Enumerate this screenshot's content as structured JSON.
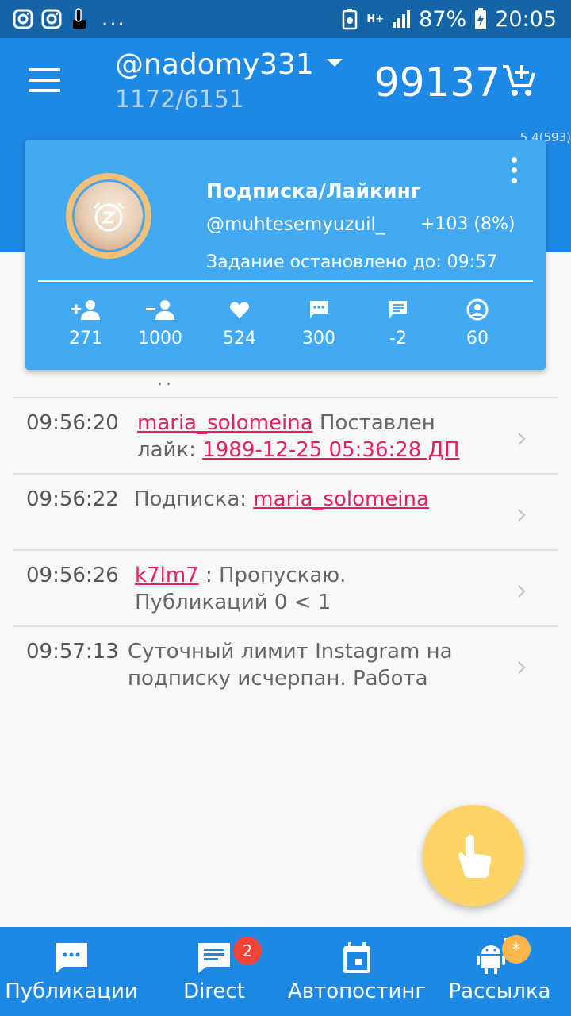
{
  "status_bar": {
    "left_icons": [
      "instagram-icon",
      "instagram-icon",
      "touch-icon"
    ],
    "more": "...",
    "battery_percent": "87%",
    "time": "20:05",
    "network": "H+"
  },
  "app_bar": {
    "username": "@nadomy331",
    "counter": "1172/6151",
    "balance": "99137"
  },
  "version": "5.4(593)",
  "task_card": {
    "title": "Подписка/Лайкинг",
    "account": "@muhtesemyuzuil_",
    "gain": "+103 (8%)",
    "status": "Задание остановлено до: 09:57",
    "stats": [
      {
        "icon": "follow-icon",
        "value": "271"
      },
      {
        "icon": "unfollow-icon",
        "value": "1000"
      },
      {
        "icon": "heart-icon",
        "value": "524"
      },
      {
        "icon": "comment-icon",
        "value": "300"
      },
      {
        "icon": "message-icon",
        "value": "-2"
      },
      {
        "icon": "profile-icon",
        "value": "60"
      }
    ]
  },
  "log": {
    "ellipsis": "..",
    "rows": [
      {
        "time": "09:56:20",
        "link": "maria_solomeina",
        "text": " Поставлен лайк: ",
        "link2": "1989-12-25 05:36:28 ДП"
      },
      {
        "time": "09:56:22",
        "text": "Подписка: ",
        "link": "maria_solomeina"
      },
      {
        "time": "09:56:26",
        "link": "k7lm7",
        "text": " : Пропускаю. Публикаций 0 < 1"
      },
      {
        "time": "09:57:13",
        "text": "Суточный лимит Instagram на подписку исчерпан. Работа"
      }
    ]
  },
  "bottom_nav": [
    {
      "label": "Публикации",
      "icon": "posts-icon"
    },
    {
      "label": "Direct",
      "icon": "direct-icon",
      "badge": "2"
    },
    {
      "label": "Автопостинг",
      "icon": "calendar-icon"
    },
    {
      "label": "Рассылка",
      "icon": "android-broadcast-icon",
      "badge": "*"
    }
  ],
  "colors": {
    "status_bar": "#1565a6",
    "primary": "#1e88e5",
    "card": "#42aaf2",
    "link": "#e91e63",
    "fab": "#fcd468",
    "badge_red": "#f44336",
    "badge_orange": "#ffb74d"
  }
}
